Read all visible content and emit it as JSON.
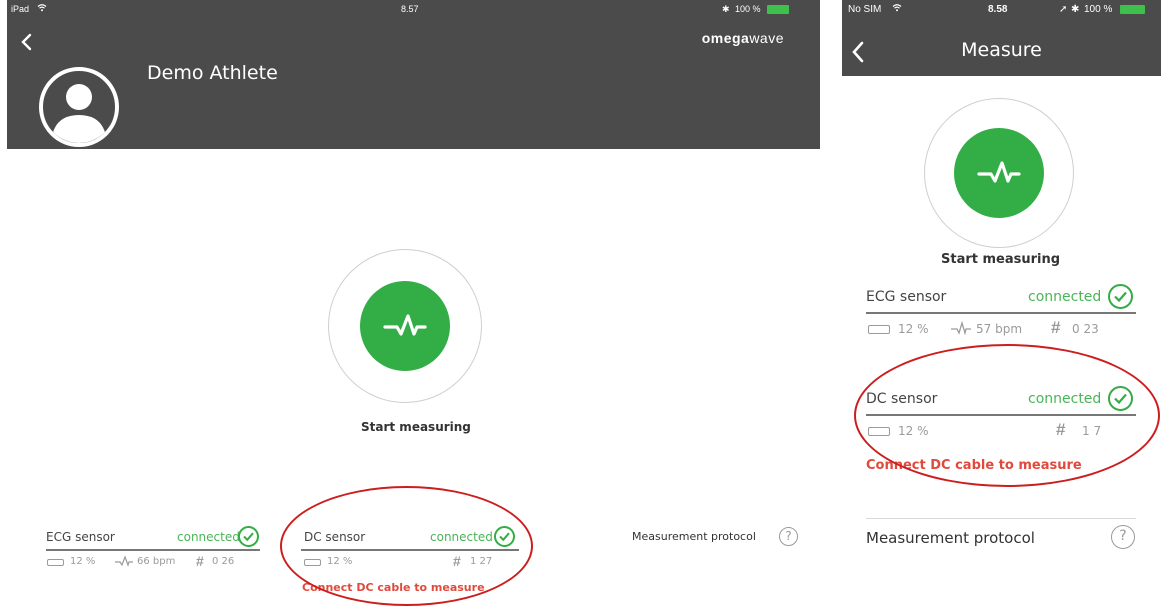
{
  "ipad": {
    "status": {
      "device": "iPad",
      "time": "8.57",
      "battery": "100 %"
    },
    "brand": {
      "part1": "omega",
      "part2": "wave"
    },
    "athlete_name": "Demo Athlete",
    "start_label": "Start measuring",
    "ecg": {
      "name": "ECG sensor",
      "status": "connected",
      "battery": "12 %",
      "bpm": "66 bpm",
      "id": "0 26"
    },
    "dc": {
      "name": "DC sensor",
      "status": "connected",
      "battery": "12 %",
      "id": "1 27",
      "warning": "Connect DC cable to measure"
    },
    "protocol_label": "Measurement protocol",
    "help_label": "?"
  },
  "phone": {
    "status": {
      "carrier": "No SIM",
      "time": "8.58",
      "battery": "100 %"
    },
    "title": "Measure",
    "start_label": "Start measuring",
    "ecg": {
      "name": "ECG sensor",
      "status": "connected",
      "battery": "12 %",
      "bpm": "57 bpm",
      "id": "0 23"
    },
    "dc": {
      "name": "DC sensor",
      "status": "connected",
      "battery": "12 %",
      "id": "1 7",
      "warning": "Connect DC cable to measure"
    },
    "protocol_label": "Measurement protocol",
    "help_label": "?"
  },
  "colors": {
    "header": "#4b4b4b",
    "accent_green": "#33ad45",
    "warning_red": "#e04a3c",
    "annotation_red": "#cc1e1e"
  },
  "icons": [
    "back-chevron-icon",
    "wifi-icon",
    "bluetooth-icon",
    "battery-icon",
    "avatar-icon",
    "heartbeat-icon",
    "check-circle-icon",
    "hash-icon",
    "help-icon",
    "location-icon"
  ]
}
